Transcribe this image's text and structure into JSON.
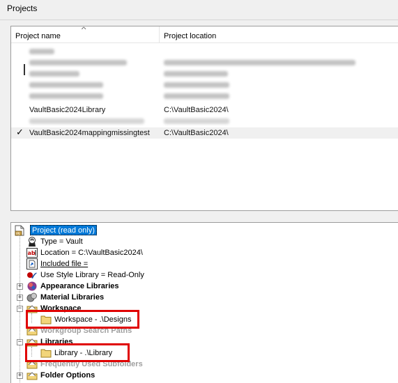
{
  "window": {
    "title": "Projects"
  },
  "list": {
    "columns": {
      "name": "Project name",
      "location": "Project location"
    },
    "rows": [
      {
        "name": "VaultBasic2024Library",
        "location": "C:\\VaultBasic2024\\"
      },
      {
        "name": "VaultBasic2024mappingmissingtest",
        "location": "C:\\VaultBasic2024\\",
        "active_mark": "✓"
      }
    ]
  },
  "tree": {
    "root": "Project (read only)",
    "items": {
      "type": "Type = Vault",
      "location": "Location = C:\\VaultBasic2024\\",
      "included": "Included file =",
      "style": "Use Style Library = Read-Only",
      "appearance": "Appearance Libraries",
      "material": "Material Libraries",
      "workspace": "Workspace",
      "workspace_child": "Workspace - .\\Designs",
      "workgroup": "Workgroup Search Paths",
      "libraries": "Libraries",
      "library_child": "Library - .\\Library",
      "frequent": "Frequently Used Subfolders",
      "folder_options": "Folder Options"
    },
    "expanders": {
      "collapsed": "+",
      "expanded": "−"
    }
  },
  "colors": {
    "selection": "#0078d7",
    "highlight": "#e00000",
    "folder": "#f2d57a"
  }
}
